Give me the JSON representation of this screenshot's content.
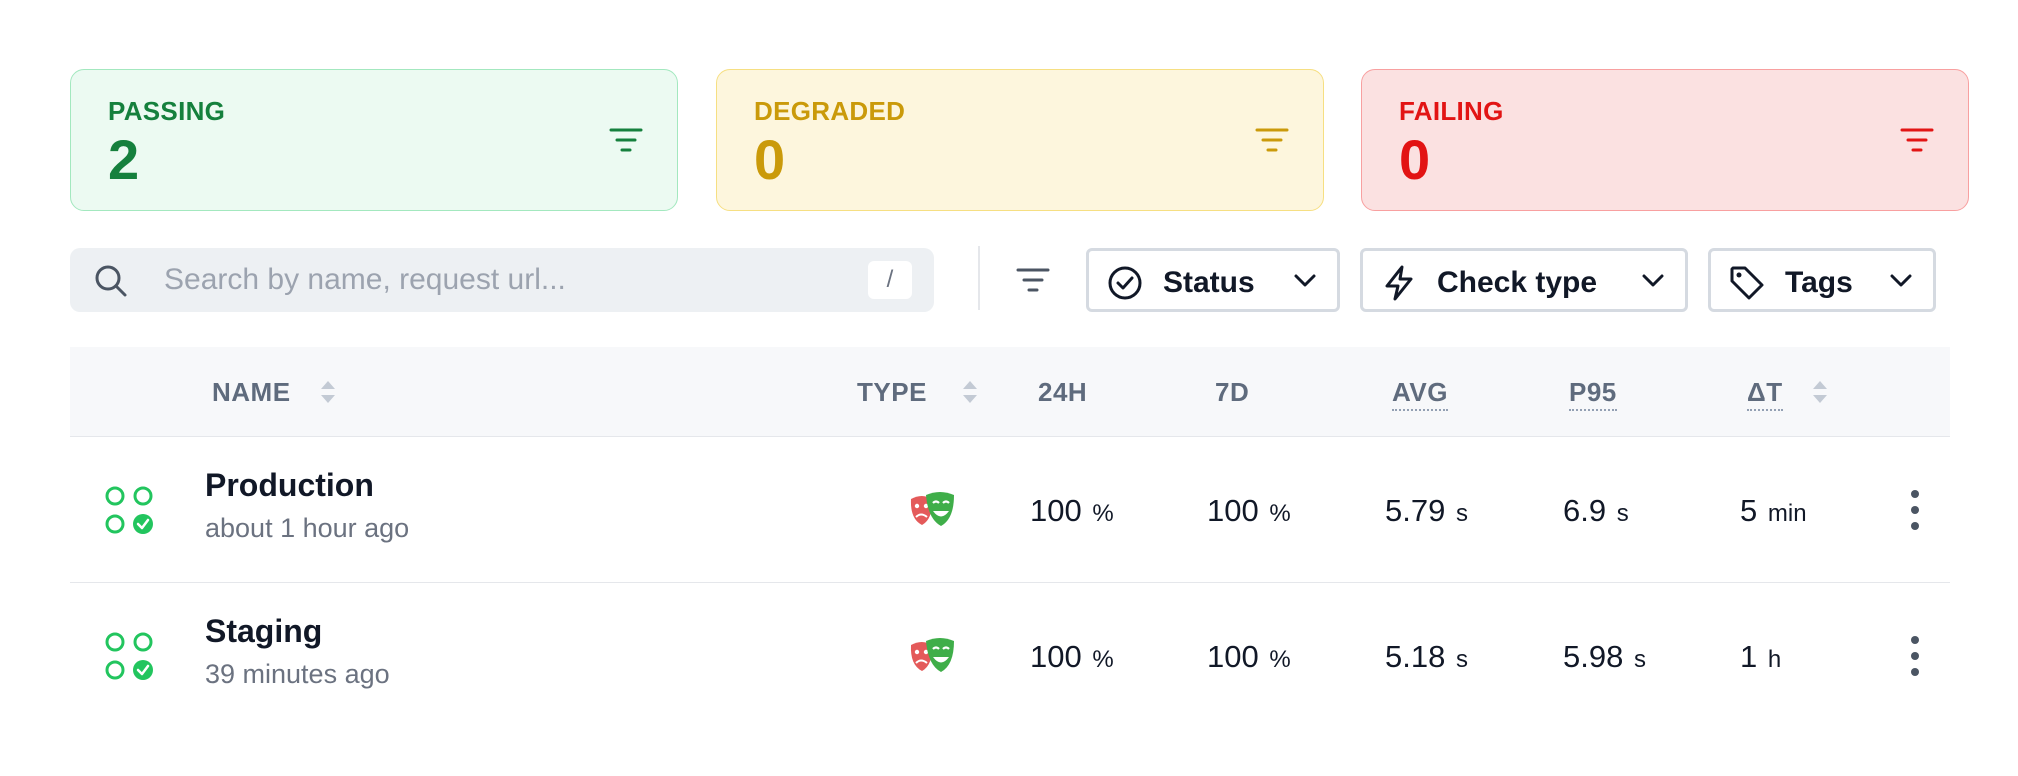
{
  "summary": {
    "passing": {
      "label": "PASSING",
      "count": "2",
      "color": "#15803d"
    },
    "degraded": {
      "label": "DEGRADED",
      "count": "0",
      "color": "#ca9a0a"
    },
    "failing": {
      "label": "FAILING",
      "count": "0",
      "color": "#e21414"
    }
  },
  "toolbar": {
    "search_placeholder": "Search by name, request url...",
    "search_shortcut": "/",
    "filters": {
      "status": "Status",
      "check_type": "Check type",
      "tags": "Tags"
    }
  },
  "table": {
    "headers": {
      "name": "NAME",
      "type": "TYPE",
      "h24": "24H",
      "d7": "7D",
      "avg": "AVG",
      "p95": "P95",
      "dt": "ΔT"
    },
    "rows": [
      {
        "name": "Production",
        "time": "about 1 hour ago",
        "type_icon": "theater-masks-icon",
        "h24": {
          "value": "100",
          "unit": "%"
        },
        "d7": {
          "value": "100",
          "unit": "%"
        },
        "avg": {
          "value": "5.79",
          "unit": "s"
        },
        "p95": {
          "value": "6.9",
          "unit": "s"
        },
        "dt": {
          "value": "5",
          "unit": "min"
        }
      },
      {
        "name": "Staging",
        "time": "39 minutes ago",
        "type_icon": "theater-masks-icon",
        "h24": {
          "value": "100",
          "unit": "%"
        },
        "d7": {
          "value": "100",
          "unit": "%"
        },
        "avg": {
          "value": "5.18",
          "unit": "s"
        },
        "p95": {
          "value": "5.98",
          "unit": "s"
        },
        "dt": {
          "value": "1",
          "unit": "h"
        }
      }
    ]
  },
  "colors": {
    "status_green": "#22c55e",
    "mask_red": "#e45a5a",
    "mask_green": "#3fae49"
  }
}
